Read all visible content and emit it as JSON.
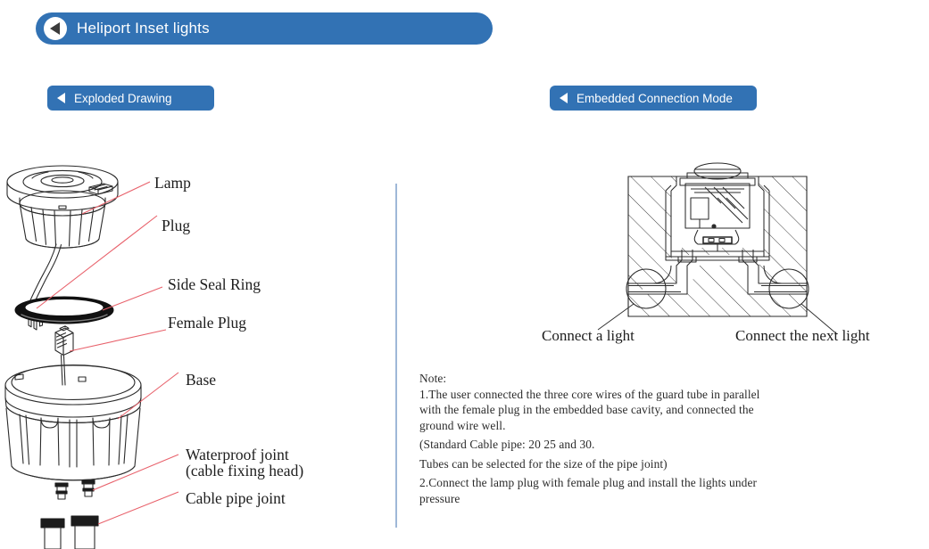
{
  "header": {
    "title": "Heliport Inset lights",
    "back_icon": "back-triangle-icon"
  },
  "tabs": [
    {
      "label": "Exploded Drawing",
      "icon": "back-triangle-icon"
    },
    {
      "label": "Embedded Connection Mode",
      "icon": "back-triangle-icon"
    }
  ],
  "colors": {
    "brand_blue": "#3272B4",
    "leader_red": "#E8616B",
    "divider_blue": "#9FB8D8",
    "line_dark": "#2b2b2b"
  },
  "exploded": {
    "labels": [
      {
        "text": "Lamp"
      },
      {
        "text": "Plug"
      },
      {
        "text": "Side Seal Ring"
      },
      {
        "text": "Female Plug"
      },
      {
        "text": "Base"
      },
      {
        "text": "Waterproof joint"
      },
      {
        "text": "(cable fixing head)"
      },
      {
        "text": "Cable pipe joint"
      }
    ]
  },
  "embedded": {
    "captions": [
      {
        "text": "Connect a light"
      },
      {
        "text": "Connect the next light"
      }
    ]
  },
  "notes": {
    "heading": "Note:",
    "lines": [
      "1.The user connected the three core wires of the guard tube in parallel",
      "with the female plug in the embedded base cavity, and connected the",
      "ground wire well.",
      "(Standard Cable pipe: 20 25 and 30.",
      "Tubes can be selected for the size of the pipe joint)",
      "2.Connect the lamp plug with female plug and install the lights under",
      "pressure"
    ]
  }
}
